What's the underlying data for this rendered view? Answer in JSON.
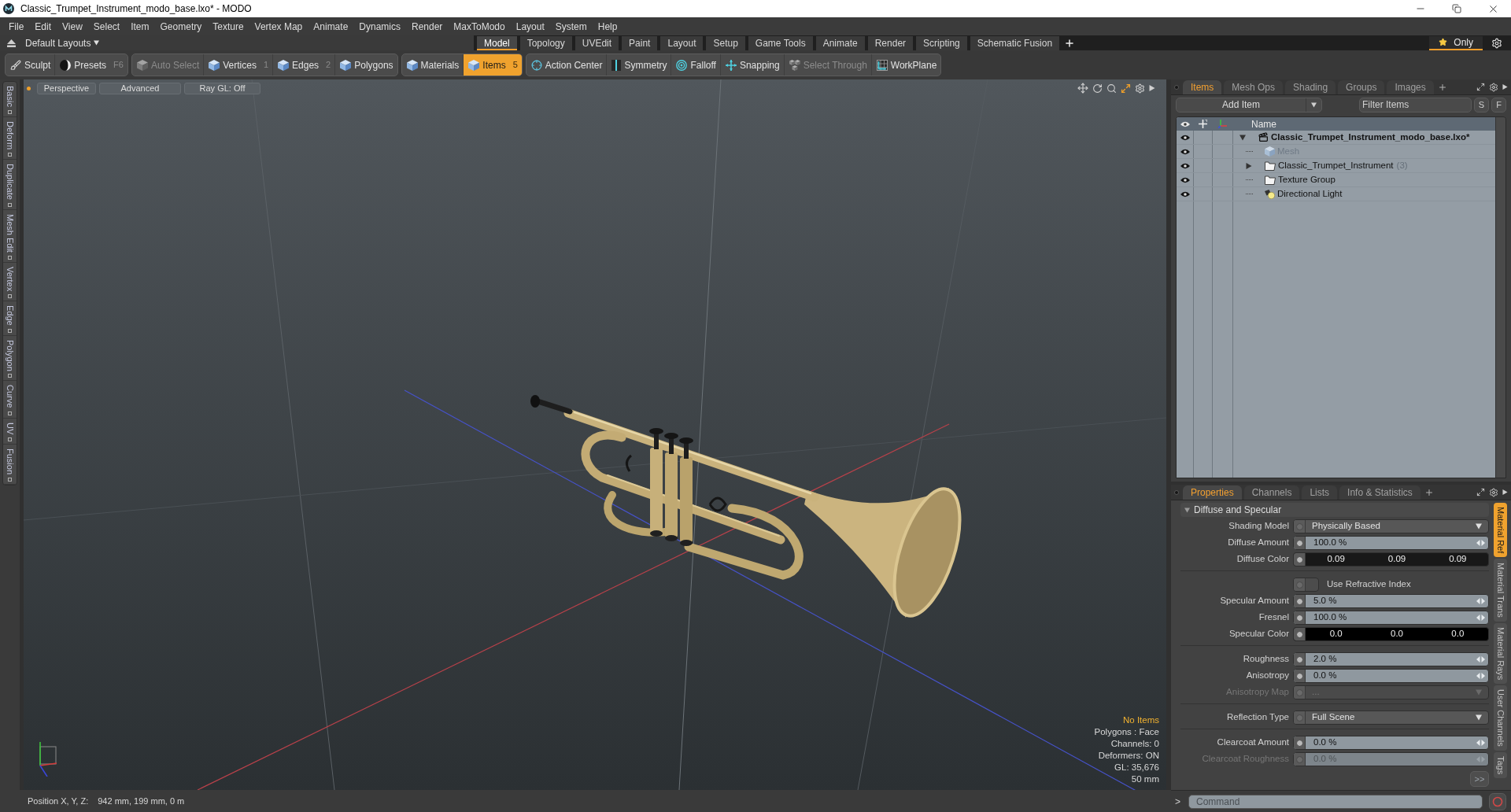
{
  "window": {
    "title": "Classic_Trumpet_Instrument_modo_base.lxo* - MODO"
  },
  "menu": [
    "File",
    "Edit",
    "View",
    "Select",
    "Item",
    "Geometry",
    "Texture",
    "Vertex Map",
    "Animate",
    "Dynamics",
    "Render",
    "MaxToModo",
    "Layout",
    "System",
    "Help"
  ],
  "layout_bar": {
    "layouts_menu": "Default Layouts",
    "tabs": [
      {
        "label": "Model",
        "selected": true
      },
      {
        "label": "Topology",
        "selected": false
      },
      {
        "label": "UVEdit",
        "selected": false
      },
      {
        "label": "Paint",
        "selected": false
      },
      {
        "label": "Layout",
        "selected": false
      },
      {
        "label": "Setup",
        "selected": false
      },
      {
        "label": "Game Tools",
        "selected": false
      },
      {
        "label": "Animate",
        "selected": false
      },
      {
        "label": "Render",
        "selected": false
      },
      {
        "label": "Scripting",
        "selected": false
      },
      {
        "label": "Schematic Fusion",
        "selected": false
      }
    ],
    "only_button": "Only"
  },
  "toolbar": {
    "groups": [
      [
        {
          "label": "Sculpt",
          "selected": false,
          "disabled": false
        },
        {
          "label": "Presets",
          "shortcut": "F6",
          "selected": false,
          "disabled": false
        }
      ],
      [
        {
          "label": "Auto Select",
          "selected": false,
          "disabled": true
        },
        {
          "label": "Vertices",
          "shortcut": "1",
          "selected": false,
          "disabled": false
        },
        {
          "label": "Edges",
          "shortcut": "2",
          "selected": false,
          "disabled": false
        },
        {
          "label": "Polygons",
          "selected": false,
          "disabled": false
        }
      ],
      [
        {
          "label": "Materials",
          "selected": false,
          "disabled": false
        },
        {
          "label": "Items",
          "shortcut": "5",
          "selected": true,
          "disabled": false
        }
      ],
      [
        {
          "label": "Action Center",
          "selected": false,
          "disabled": false
        },
        {
          "label": "Symmetry",
          "selected": false,
          "disabled": false
        },
        {
          "label": "Falloff",
          "selected": false,
          "disabled": false
        },
        {
          "label": "Snapping",
          "selected": false,
          "disabled": false
        },
        {
          "label": "Select Through",
          "selected": false,
          "disabled": true
        },
        {
          "label": "WorkPlane",
          "selected": false,
          "disabled": false
        }
      ]
    ]
  },
  "tool_tabs": [
    "Basic",
    "Deform",
    "Duplicate",
    "Mesh Edit",
    "Vertex",
    "Edge",
    "Polygon",
    "Curve",
    "UV",
    "Fusion"
  ],
  "viewport": {
    "buttons": [
      "Perspective",
      "Advanced",
      "Ray GL: Off"
    ],
    "info": [
      {
        "text": "No Items",
        "kind": "status"
      },
      {
        "text": "Polygons : Face",
        "kind": "stat"
      },
      {
        "text": "Channels: 0",
        "kind": "stat"
      },
      {
        "text": "Deformers: ON",
        "kind": "stat"
      },
      {
        "text": "GL: 35,676",
        "kind": "stat"
      },
      {
        "text": "50 mm",
        "kind": "stat"
      }
    ]
  },
  "items_panel": {
    "tabs": [
      {
        "label": "Items",
        "selected": true
      },
      {
        "label": "Mesh Ops",
        "selected": false
      },
      {
        "label": "Shading",
        "selected": false
      },
      {
        "label": "Groups",
        "selected": false
      },
      {
        "label": "Images",
        "selected": false
      }
    ],
    "add_item": "Add Item",
    "filter": {
      "placeholder": "Filter Items"
    },
    "filter_buttons": [
      "S",
      "F"
    ],
    "name_column": "Name",
    "tree": [
      {
        "name": "Classic_Trumpet_Instrument_modo_base.lxo*",
        "kind": "scene",
        "visible": true,
        "disabled": false,
        "expanded": true,
        "children": [
          {
            "name": "Mesh",
            "kind": "mesh",
            "visible": true,
            "disabled": true
          },
          {
            "name": "Classic_Trumpet_Instrument",
            "count": "(3)",
            "kind": "group",
            "visible": true,
            "disabled": false,
            "expanded": false
          },
          {
            "name": "Texture Group",
            "kind": "group",
            "visible": true,
            "disabled": false
          },
          {
            "name": "Directional Light",
            "kind": "light",
            "visible": true,
            "disabled": false
          }
        ]
      }
    ]
  },
  "properties_panel": {
    "tabs": [
      {
        "label": "Properties",
        "selected": true
      },
      {
        "label": "Channels",
        "selected": false
      },
      {
        "label": "Lists",
        "selected": false
      },
      {
        "label": "Info & Statistics",
        "selected": false
      }
    ],
    "section": {
      "title": "Diffuse and Specular",
      "expanded": true
    },
    "rows": [
      {
        "kind": "dropdown",
        "label": "Shading Model",
        "value": "Physically Based",
        "disabled": false
      },
      {
        "kind": "percent",
        "label": "Diffuse Amount",
        "value": "100.0 %",
        "disabled": false
      },
      {
        "kind": "color",
        "label": "Diffuse Color",
        "values": [
          "0.09",
          "0.09",
          "0.09"
        ],
        "color": "#181818",
        "disabled": false
      },
      {
        "kind": "divider"
      },
      {
        "kind": "checkbox",
        "label": "Use Refractive Index",
        "checked": false,
        "disabled": false
      },
      {
        "kind": "percent",
        "label": "Specular Amount",
        "value": "5.0 %",
        "disabled": false
      },
      {
        "kind": "percent",
        "label": "Fresnel",
        "value": "100.0 %",
        "disabled": false
      },
      {
        "kind": "color",
        "label": "Specular Color",
        "values": [
          "0.0",
          "0.0",
          "0.0"
        ],
        "color": "#000000",
        "disabled": false
      },
      {
        "kind": "divider"
      },
      {
        "kind": "percent",
        "label": "Roughness",
        "value": "2.0 %",
        "disabled": false
      },
      {
        "kind": "percent",
        "label": "Anisotropy",
        "value": "0.0 %",
        "disabled": false
      },
      {
        "kind": "dropdown",
        "label": "Anisotropy Map",
        "value": "...",
        "disabled": true
      },
      {
        "kind": "divider"
      },
      {
        "kind": "dropdown",
        "label": "Reflection Type",
        "value": "Full Scene",
        "disabled": false
      },
      {
        "kind": "divider"
      },
      {
        "kind": "percent",
        "label": "Clearcoat Amount",
        "value": "0.0 %",
        "disabled": false
      },
      {
        "kind": "percent",
        "label": "Clearcoat Roughness",
        "value": "0.0 %",
        "disabled": true
      }
    ],
    "more_button": ">>",
    "side_tabs": [
      {
        "label": "Material Ref",
        "selected": true
      },
      {
        "label": "Material Trans",
        "selected": false
      },
      {
        "label": "Material Rays",
        "selected": false
      },
      {
        "label": "User Channels",
        "selected": false
      },
      {
        "label": "Tags",
        "selected": false
      }
    ]
  },
  "command": {
    "prompt": ">",
    "placeholder": "Command"
  },
  "status_bar": {
    "label": "Position X, Y, Z:",
    "value": "942 mm, 199 mm, 0 m"
  }
}
